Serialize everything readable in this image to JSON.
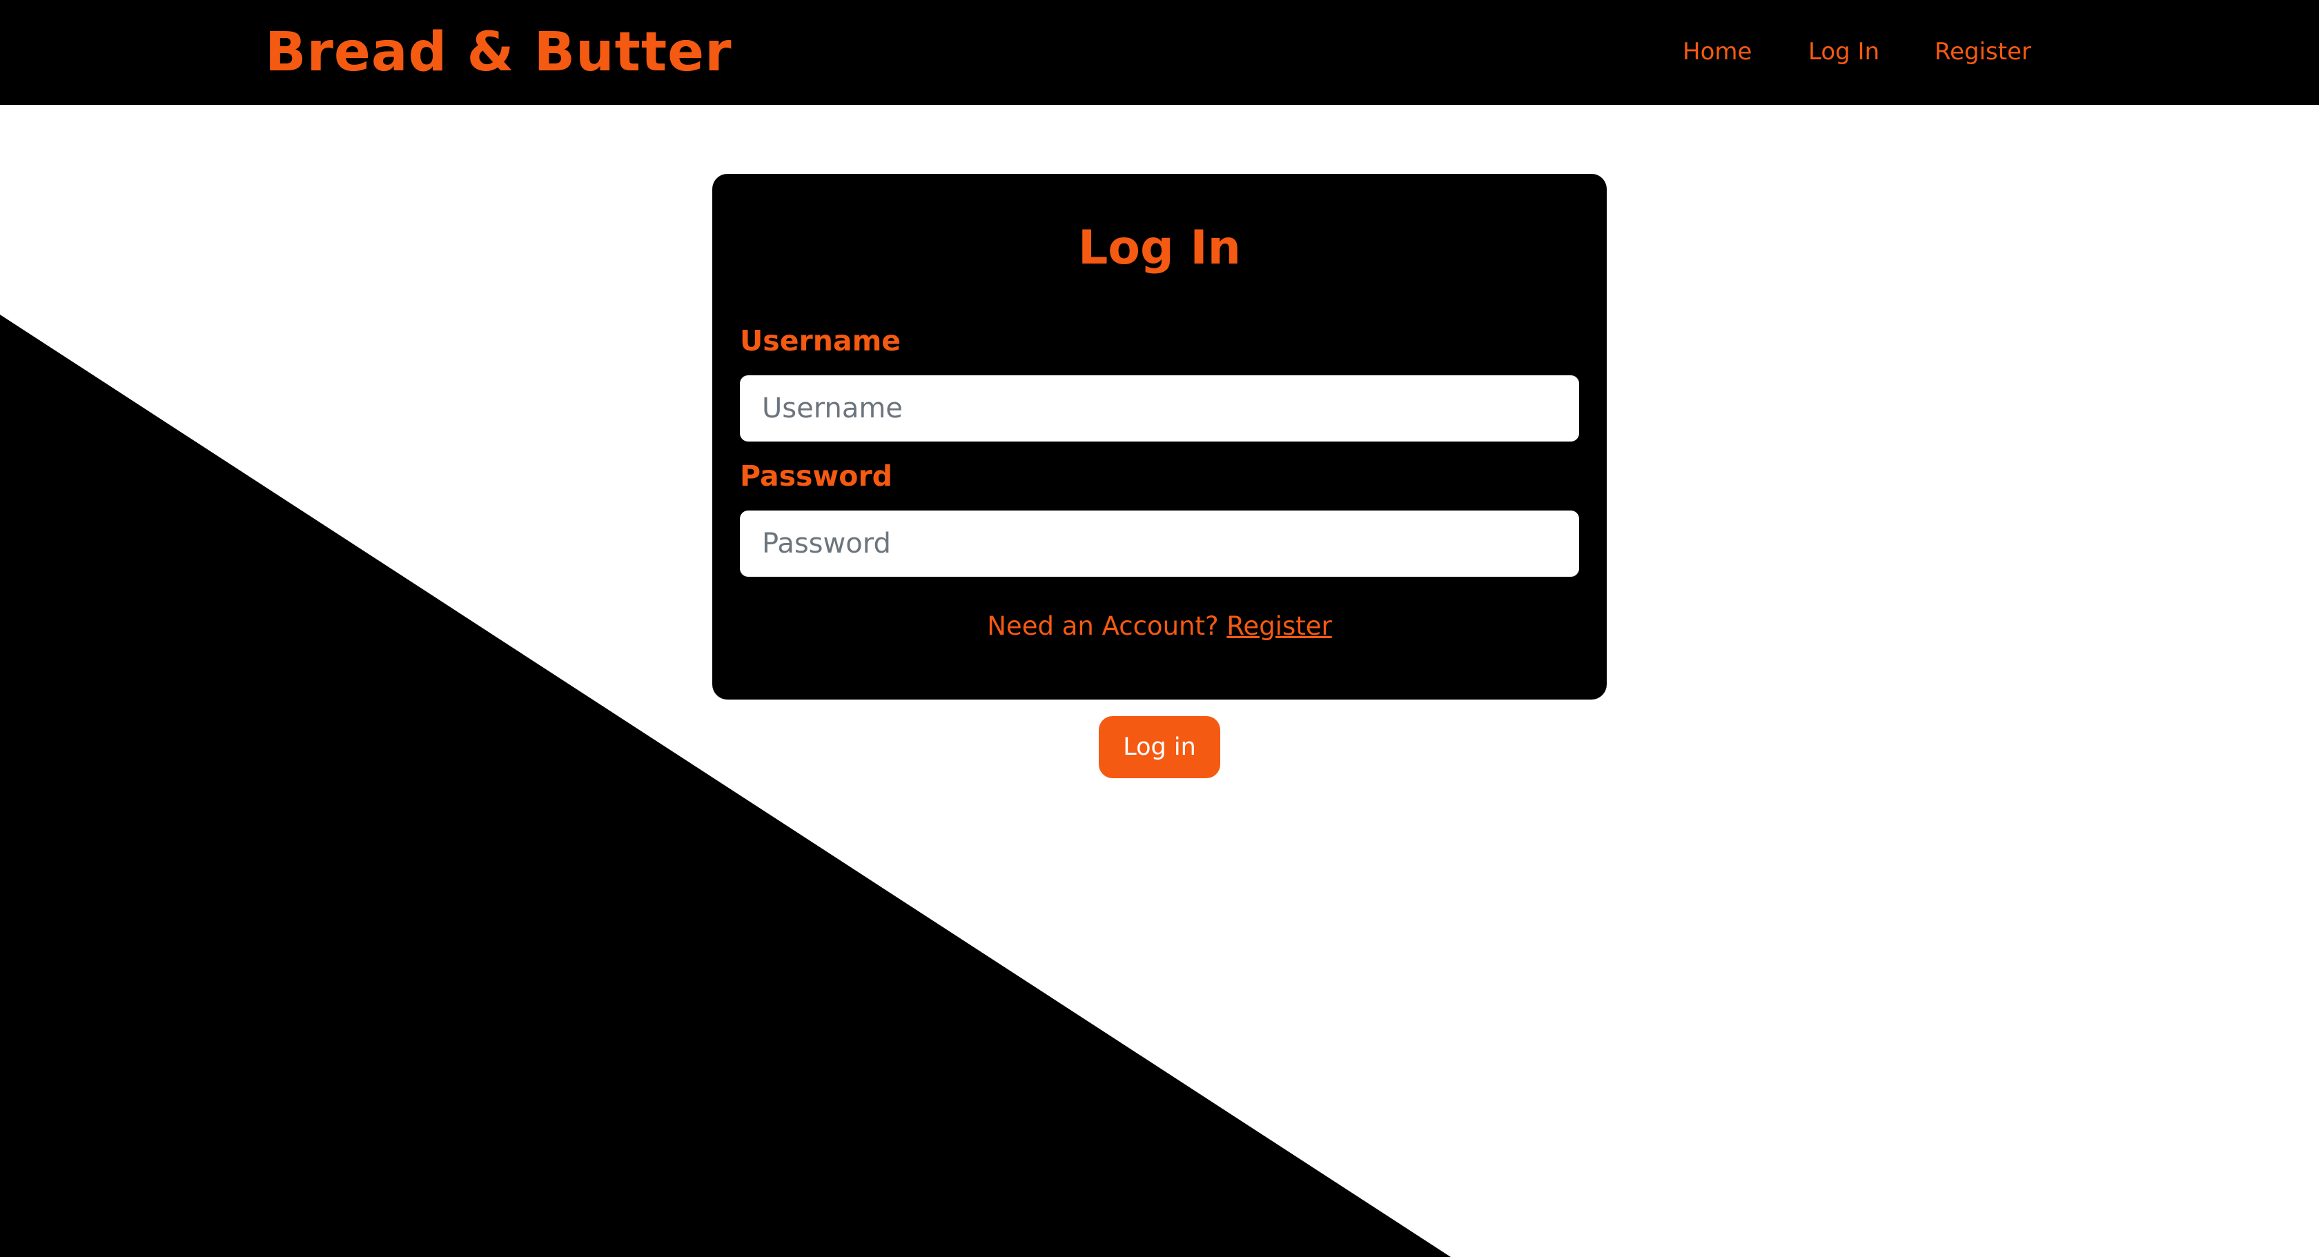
{
  "header": {
    "brand": "Bread & Butter",
    "nav": {
      "home": "Home",
      "login": "Log In",
      "register": "Register"
    }
  },
  "login_form": {
    "title": "Log In",
    "username_label": "Username",
    "username_placeholder": "Username",
    "username_value": "",
    "password_label": "Password",
    "password_placeholder": "Password",
    "password_value": "",
    "account_prompt": "Need an Account?",
    "register_link": "Register",
    "submit_label": "Log in"
  },
  "colors": {
    "accent": "#f55a12",
    "navbar": "#000000",
    "card": "#000000",
    "background": "#ffffff",
    "diagonal": "#000000"
  }
}
